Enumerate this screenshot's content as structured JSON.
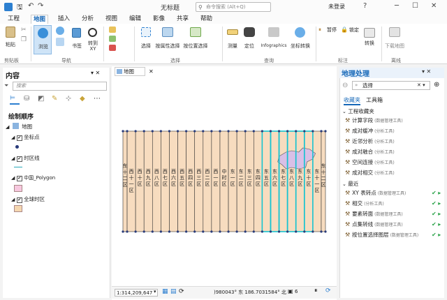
{
  "window": {
    "title": "无标题",
    "search_placeholder": "命令搜索 (Alt+Q)",
    "user": "未登录"
  },
  "menus": [
    "工程",
    "地图",
    "插入",
    "分析",
    "视图",
    "编辑",
    "影像",
    "共享",
    "帮助"
  ],
  "active_menu": "地图",
  "ribbon": {
    "buttons": [
      {
        "label": "粘贴"
      },
      {
        "label": "浏览"
      },
      {
        "label": "书签"
      },
      {
        "label": "转到 XY"
      },
      {
        "label": "选择"
      },
      {
        "label": "按属性选择"
      },
      {
        "label": "按位置选择"
      },
      {
        "label": "测量"
      },
      {
        "label": "定位"
      },
      {
        "label": "Infographics"
      },
      {
        "label": "坐标转换"
      },
      {
        "label": "暂停"
      },
      {
        "label": "锁定"
      },
      {
        "label": "转换"
      },
      {
        "label": "下载地图"
      }
    ],
    "groups": [
      "剪贴板",
      "导航",
      "选择",
      "查询",
      "标注",
      "离线"
    ]
  },
  "contents": {
    "title": "内容",
    "search_placeholder": "搜索",
    "drawing_order": "绘制顺序",
    "layers": [
      {
        "name": "地图"
      },
      {
        "name": "坐标点",
        "symbol": "point"
      },
      {
        "name": "时区线",
        "symbol": "line"
      },
      {
        "name": "中国_Polygon",
        "symbol": "polygon-pink"
      },
      {
        "name": "全球时区",
        "symbol": "polygon-tan"
      }
    ]
  },
  "map": {
    "tab": "地图",
    "zones": [
      "东十二区",
      "西十一区",
      "西十区",
      "西九区",
      "西八区",
      "西七区",
      "西六区",
      "西五区",
      "西四区",
      "西三区",
      "西二区",
      "西一区",
      "中时区",
      "东一区",
      "东二区",
      "东三区",
      "东四区",
      "东五区",
      "东六区",
      "东七区",
      "东八区",
      "东九区",
      "东十区",
      "东十一区",
      "东十二区"
    ],
    "highlighted_zones": [
      17,
      18,
      19,
      20,
      21,
      22
    ]
  },
  "status": {
    "scale": "1:314,209,647",
    "coords": ")980043° 东  186.7031584° 北",
    "selected": "6"
  },
  "geoprocessing": {
    "title": "地理处理",
    "search_value": "选择",
    "tabs": [
      "收藏夹",
      "工具箱"
    ],
    "active_tab": "收藏夹",
    "favorites_header": "工程收藏夹",
    "favorites": [
      {
        "name": "计算字段",
        "sub": "(数据管理工具)"
      },
      {
        "name": "成对缓冲",
        "sub": "(分析工具)"
      },
      {
        "name": "近邻分析",
        "sub": "(分析工具)"
      },
      {
        "name": "成对融合",
        "sub": "(分析工具)"
      },
      {
        "name": "空间连接",
        "sub": "(分析工具)"
      },
      {
        "name": "成对相交",
        "sub": "(分析工具)"
      }
    ],
    "recent_header": "最近",
    "recent": [
      {
        "name": "XY 表转点",
        "sub": "(数据管理工具)"
      },
      {
        "name": "相交",
        "sub": "(分析工具)"
      },
      {
        "name": "要素转面",
        "sub": "(数据管理工具)"
      },
      {
        "name": "点集转线",
        "sub": "(数据管理工具)"
      },
      {
        "name": "按位置选择图层",
        "sub": "(数据管理工具)"
      }
    ]
  }
}
